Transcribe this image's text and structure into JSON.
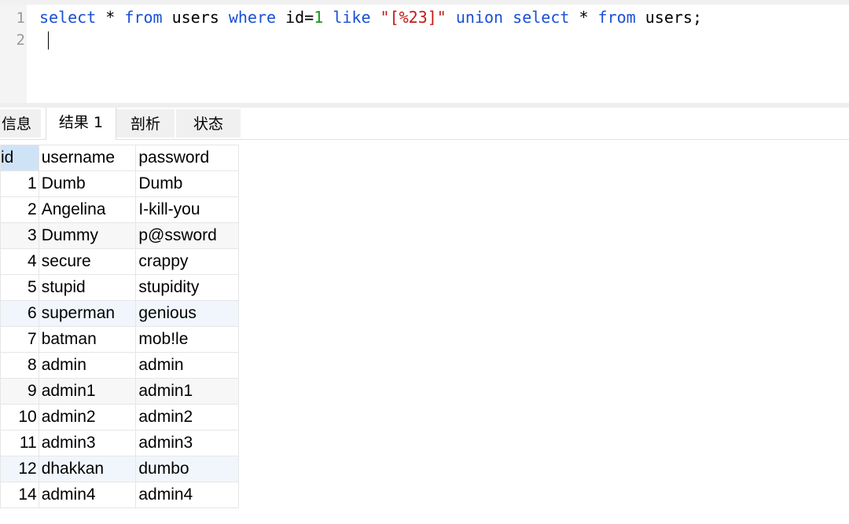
{
  "editor": {
    "line_numbers": [
      "1",
      "2"
    ],
    "query": {
      "t1": "select",
      "t2": " * ",
      "t3": "from",
      "t4": " users ",
      "t5": "where",
      "t6": " id=",
      "t7": "1",
      "t8": " ",
      "t9": "like",
      "t10": " ",
      "t11": "\"[%23]\"",
      "t12": " ",
      "t13": "union",
      "t14": " ",
      "t15": "select",
      "t16": " * ",
      "t17": "from",
      "t18": " users;"
    }
  },
  "tabs": [
    {
      "label": "信息"
    },
    {
      "label": "结果 1"
    },
    {
      "label": "剖析"
    },
    {
      "label": "状态"
    }
  ],
  "active_tab": "结果 1",
  "grid": {
    "columns": [
      "id",
      "username",
      "password"
    ],
    "rows": [
      {
        "id": "1",
        "username": "Dumb",
        "password": "Dumb"
      },
      {
        "id": "2",
        "username": "Angelina",
        "password": "I-kill-you"
      },
      {
        "id": "3",
        "username": "Dummy",
        "password": "p@ssword"
      },
      {
        "id": "4",
        "username": "secure",
        "password": "crappy"
      },
      {
        "id": "5",
        "username": "stupid",
        "password": "stupidity"
      },
      {
        "id": "6",
        "username": "superman",
        "password": "genious"
      },
      {
        "id": "7",
        "username": "batman",
        "password": "mob!le"
      },
      {
        "id": "8",
        "username": "admin",
        "password": "admin"
      },
      {
        "id": "9",
        "username": "admin1",
        "password": "admin1"
      },
      {
        "id": "10",
        "username": "admin2",
        "password": "admin2"
      },
      {
        "id": "11",
        "username": "admin3",
        "password": "admin3"
      },
      {
        "id": "12",
        "username": "dhakkan",
        "password": "dumbo"
      },
      {
        "id": "14",
        "username": "admin4",
        "password": "admin4"
      }
    ]
  },
  "colors": {
    "keyword": "#1a4fd6",
    "number": "#1a9a1a",
    "string": "#c41a16",
    "selected_header": "#cfe3f7"
  }
}
